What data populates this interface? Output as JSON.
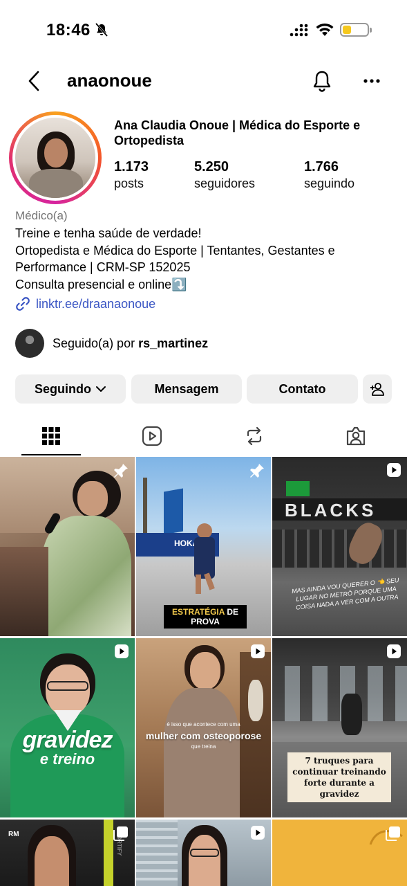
{
  "status_bar": {
    "time": "18:46",
    "battery_level": 0.35,
    "battery_color": "#f5c81e"
  },
  "header": {
    "username": "anaonoue",
    "back_icon": "chevron-left-icon",
    "notification_icon": "bell-icon",
    "more_icon": "more-horizontal-icon"
  },
  "profile": {
    "display_name": "Ana Claudia Onoue | Médica do Esporte e Ortopedista",
    "stats": [
      {
        "value": "1.173",
        "label": "posts"
      },
      {
        "value": "5.250",
        "label": "seguidores"
      },
      {
        "value": "1.766",
        "label": "seguindo"
      }
    ],
    "category": "Médico(a)",
    "bio_lines": [
      "Treine e tenha saúde de verdade!",
      "Ortopedista e Médica do Esporte | Tentantes, Gestantes e",
      "Performance | CRM-SP 152025",
      "Consulta presencial e online⤵️"
    ],
    "link": "linktr.ee/draanaonoue",
    "followed_by_prefix": "Seguido(a) por",
    "followed_by_user": "rs_martinez"
  },
  "actions": {
    "following": "Seguindo",
    "message": "Mensagem",
    "contact": "Contato"
  },
  "tabs": [
    {
      "name": "grid",
      "icon": "grid-icon",
      "active": true
    },
    {
      "name": "reels",
      "icon": "reels-icon",
      "active": false
    },
    {
      "name": "reposts",
      "icon": "repost-icon",
      "active": false
    },
    {
      "name": "tagged",
      "icon": "tagged-icon",
      "active": false
    }
  ],
  "posts": [
    {
      "badge": "pin-icon",
      "caption": ""
    },
    {
      "badge": "pin-icon",
      "caption_a": "ESTRATÉGIA",
      "caption_b": "DE PROVA",
      "sign": "HOKA"
    },
    {
      "badge": "reel-icon",
      "sign": "BLACKS",
      "caption": "MAS AINDA VOU QUERER O 👈 SEU LUGAR NO METRÔ PORQUE UMA COISA NADA A VER COM A OUTRA"
    },
    {
      "badge": "reel-icon",
      "caption_a": "gravidez",
      "caption_b": "e treino"
    },
    {
      "badge": "reel-icon",
      "caption_a": "é isso que acontece com uma",
      "caption_b": "mulher com osteoporose",
      "caption_c": "que treina"
    },
    {
      "badge": "reel-icon",
      "caption": "7 truques para continuar treinando forte durante a gravidez"
    },
    {
      "badge": "carousel-icon",
      "logo": "RM",
      "side_text": "FORTIFY"
    },
    {
      "badge": "reel-icon"
    },
    {
      "badge": "carousel-icon"
    }
  ]
}
